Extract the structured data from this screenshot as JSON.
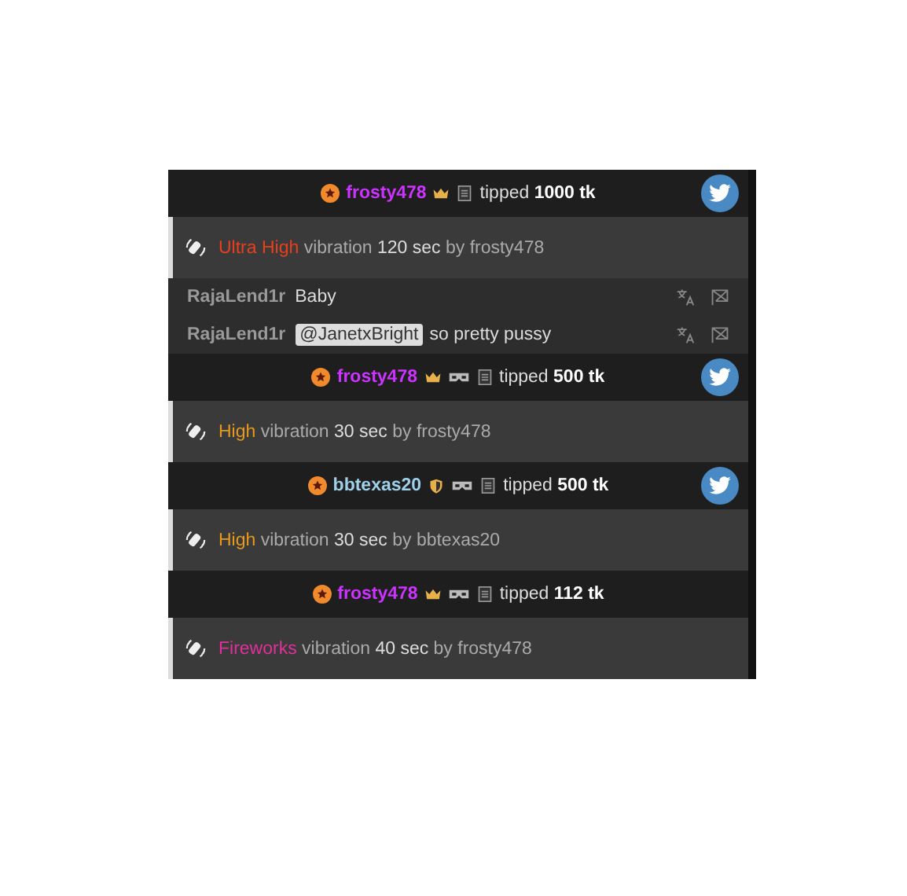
{
  "messages": [
    {
      "kind": "tip",
      "user": "frosty478",
      "color": "#cc33ff",
      "badges": [
        {
          "kind": "crown"
        },
        {
          "kind": "note"
        }
      ],
      "verb": "tipped",
      "amount": "1000 tk",
      "share": true
    },
    {
      "kind": "vibration",
      "level_name": "Ultra High",
      "color": "#e8401c",
      "word": "vibration",
      "duration": "120 sec",
      "by": "by frosty478"
    },
    {
      "kind": "chat",
      "user": "RajaLend1r",
      "text": "Baby"
    },
    {
      "kind": "chat",
      "user": "RajaLend1r",
      "mention": "@JanetxBright",
      "text": "so pretty pussy"
    },
    {
      "kind": "tip",
      "user": "frosty478",
      "color": "#cc33ff",
      "badges": [
        {
          "kind": "crown"
        },
        {
          "kind": "vr"
        },
        {
          "kind": "note"
        }
      ],
      "verb": "tipped",
      "amount": "500 tk",
      "share": true
    },
    {
      "kind": "vibration",
      "level_name": "High",
      "color": "#e89a1c",
      "word": "vibration",
      "duration": "30 sec",
      "by": "by frosty478"
    },
    {
      "kind": "tip",
      "user": "bbtexas20",
      "color": "#9fd0ea",
      "badges": [
        {
          "kind": "shield"
        },
        {
          "kind": "vr"
        },
        {
          "kind": "note"
        }
      ],
      "verb": "tipped",
      "amount": "500 tk",
      "share": true
    },
    {
      "kind": "vibration",
      "level_name": "High",
      "color": "#e89a1c",
      "word": "vibration",
      "duration": "30 sec",
      "by": "by bbtexas20"
    },
    {
      "kind": "tip",
      "user": "frosty478",
      "color": "#cc33ff",
      "badges": [
        {
          "kind": "crown"
        },
        {
          "kind": "vr"
        },
        {
          "kind": "note"
        }
      ],
      "verb": "tipped",
      "amount": "112 tk",
      "share": false
    },
    {
      "kind": "vibration",
      "level_name": "Fireworks",
      "color": "#e0309a",
      "word": "vibration",
      "duration": "40 sec",
      "by": "by frosty478"
    }
  ]
}
